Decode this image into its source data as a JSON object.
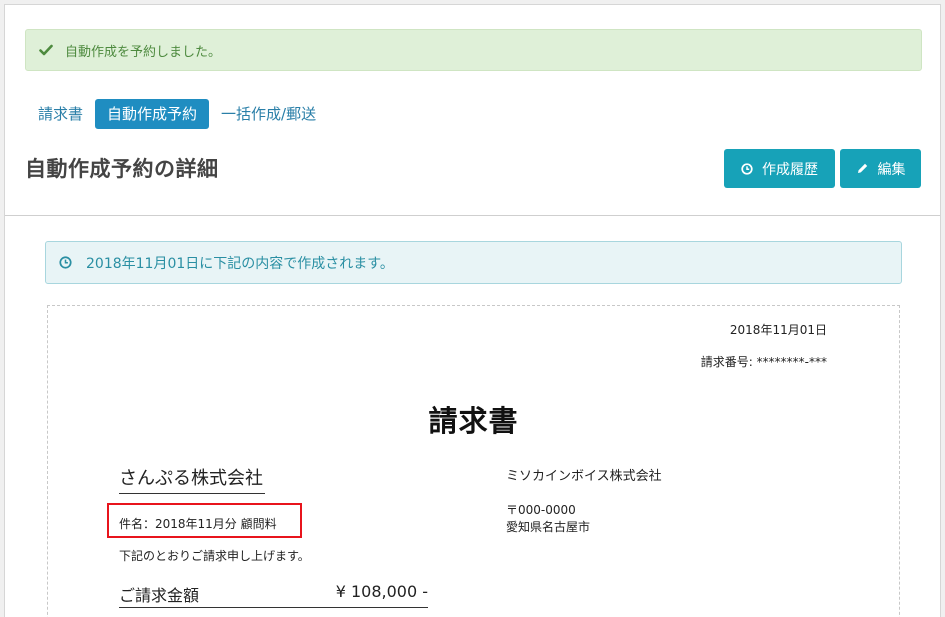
{
  "notice": {
    "message": "自動作成を予約しました。",
    "icon": "check-icon"
  },
  "tabs": [
    {
      "label": "請求書",
      "active": false
    },
    {
      "label": "自動作成予約",
      "active": true
    },
    {
      "label": "一括作成/郵送",
      "active": false
    }
  ],
  "page": {
    "title": "自動作成予約の詳細"
  },
  "actions": {
    "history_label": "作成履歴",
    "history_icon": "clock-icon",
    "edit_label": "編集",
    "edit_icon": "pencil-icon"
  },
  "schedule_info": {
    "message": "2018年11月01日に下記の内容で作成されます。",
    "icon": "clock-icon"
  },
  "invoice": {
    "date": "2018年11月01日",
    "number_label": "請求番号:",
    "number_value": "********-***",
    "title": "請求書",
    "client_name": "さんぷる株式会社",
    "subject": "件名：2018年11月分 顧問料",
    "greeting": "下記のとおりご請求申し上げます。",
    "amount_label": "ご請求金額",
    "amount_value": "¥ 108,000 -",
    "sender_name": "ミソカインボイス株式会社",
    "sender_zip": "〒000-0000",
    "sender_address": "愛知県名古屋市"
  },
  "colors": {
    "success_bg": "#dff0d8",
    "success_text": "#4d8a3e",
    "tab_active": "#1f8dc1",
    "button": "#17a2b8",
    "info_bg": "#e8f4f6",
    "info_text": "#2a8fa3",
    "highlight_border": "#e8141c"
  }
}
